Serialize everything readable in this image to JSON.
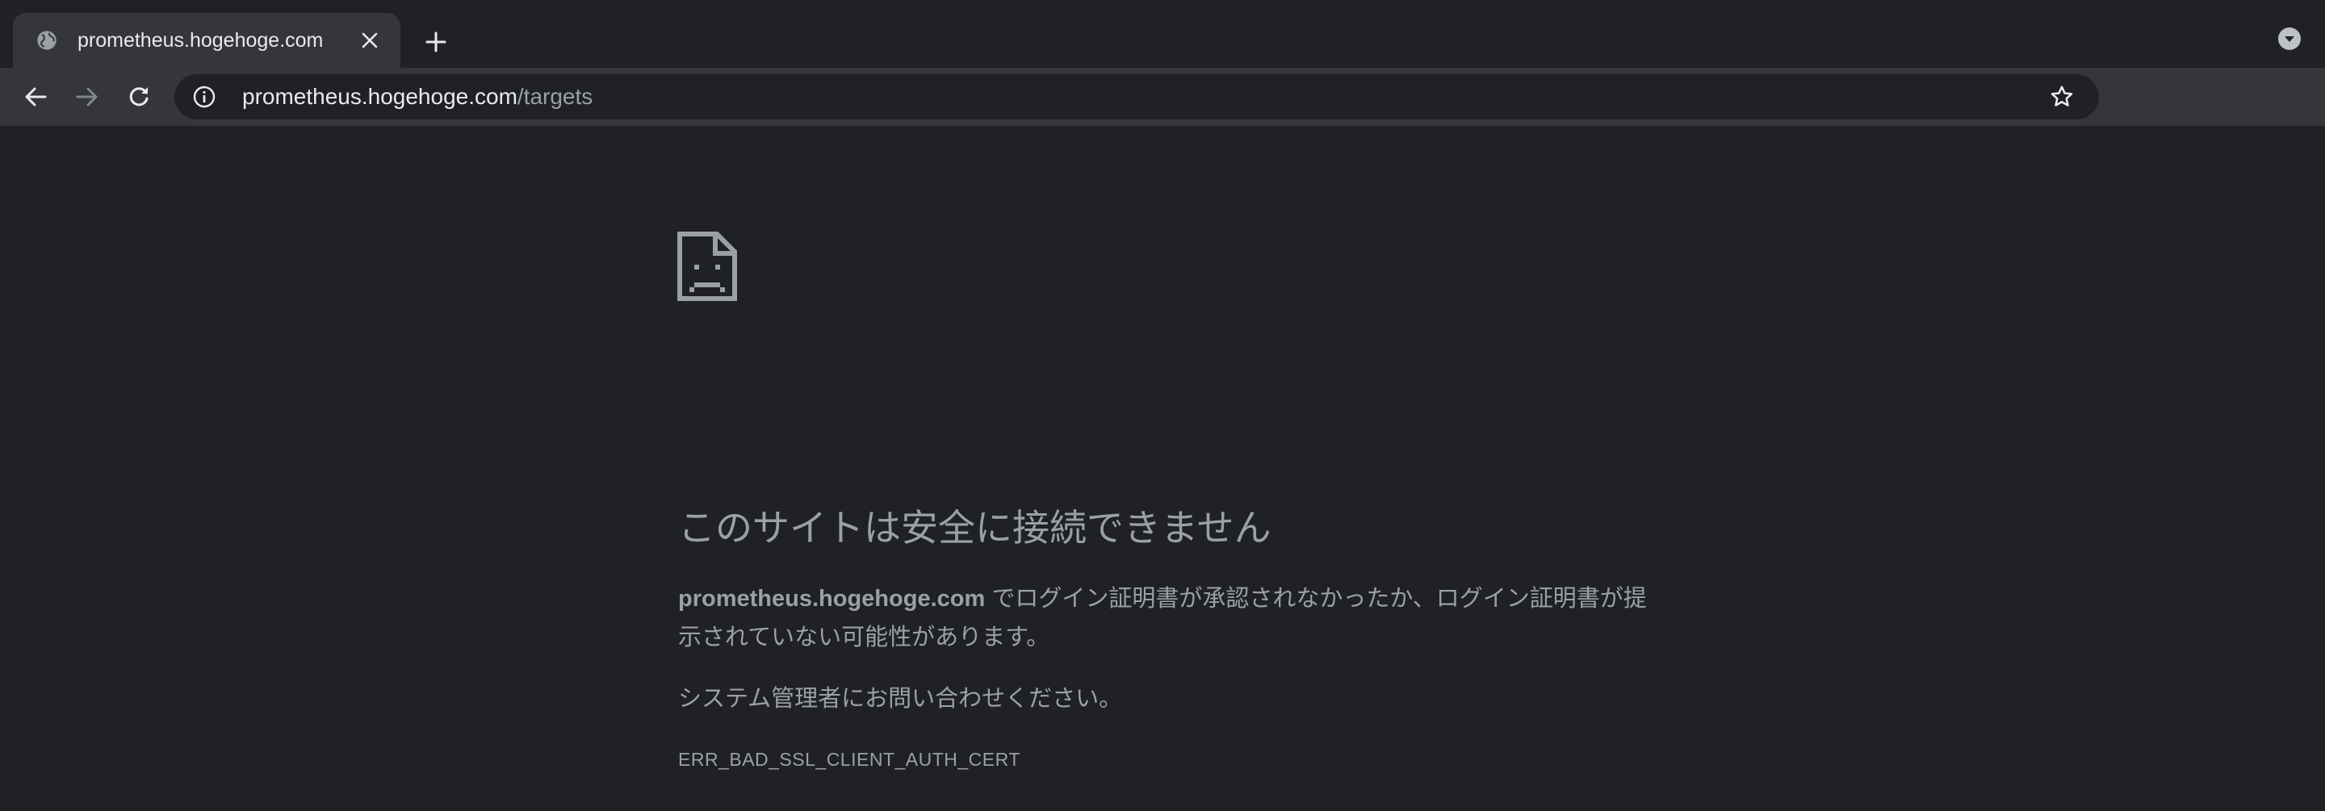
{
  "browser": {
    "tab": {
      "title": "prometheus.hogehoge.com"
    },
    "address_bar": {
      "host": "prometheus.hogehoge.com",
      "path": "/targets"
    }
  },
  "error_page": {
    "heading": "このサイトは安全に接続できません",
    "description_host": "prometheus.hogehoge.com",
    "description_text": " でログイン証明書が承認されなかったか、ログイン証明書が提示されていない可能性があります。",
    "advice": "システム管理者にお問い合わせください。",
    "error_code": "ERR_BAD_SSL_CLIENT_AUTH_CERT"
  },
  "icons": {
    "tab_favicon": "globe-icon",
    "tab_close": "close-icon",
    "new_tab": "plus-icon",
    "tab_search": "chevron-down-circle-icon",
    "back": "arrow-left-icon",
    "forward": "arrow-right-icon",
    "reload": "reload-icon",
    "site_info": "info-icon",
    "bookmark": "star-icon",
    "error": "sad-document-icon"
  },
  "colors": {
    "background": "#202124",
    "toolbar": "#35363a",
    "text_primary": "#e8eaed",
    "text_secondary": "#9aa0a6"
  }
}
